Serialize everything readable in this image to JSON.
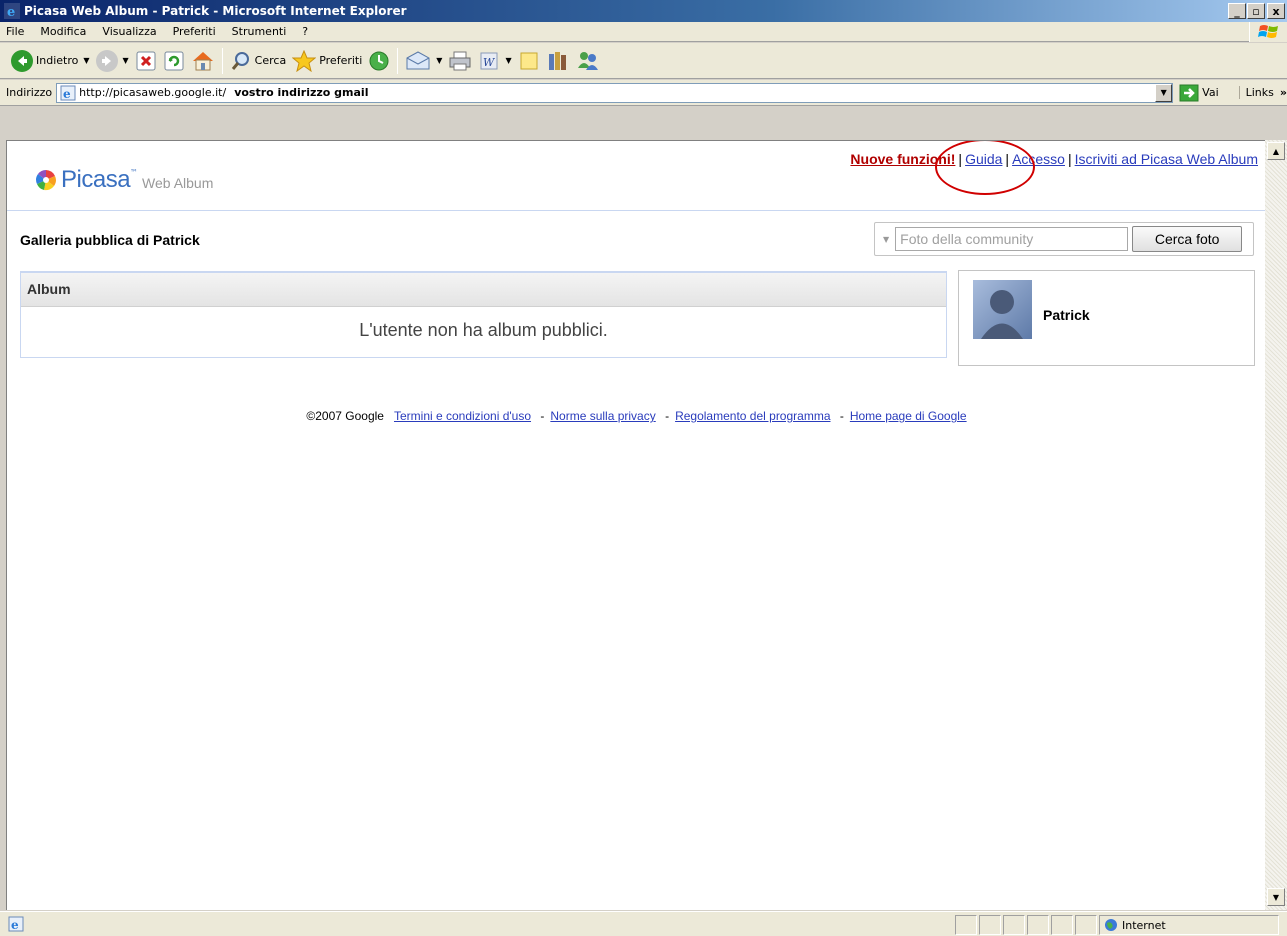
{
  "window": {
    "title": "Picasa Web Album - Patrick - Microsoft Internet Explorer",
    "min": "_",
    "max": "▫",
    "close": "x"
  },
  "menu": [
    "File",
    "Modifica",
    "Visualizza",
    "Preferiti",
    "Strumenti",
    "?"
  ],
  "toolbar": {
    "back": "Indietro",
    "search": "Cerca",
    "favorites": "Preferiti"
  },
  "address": {
    "label": "Indirizzo",
    "url": "http://picasaweb.google.it/",
    "hint": "vostro indirizzo gmail",
    "go": "Vai",
    "links": "Links",
    "links_more": "»"
  },
  "picasa": {
    "logo": "Picasa",
    "tm": "™",
    "logo_sub": "Web Album",
    "links": {
      "new_features": "Nuove funzioni!",
      "help": "Guida",
      "login": "Accesso",
      "signup": "Iscriviti ad Picasa Web Album"
    },
    "gallery_title": "Galleria pubblica di Patrick",
    "search_placeholder": "Foto della community",
    "search_button": "Cerca foto",
    "album_header": "Album",
    "album_empty": "L'utente non ha album pubblici.",
    "profile_name": "Patrick"
  },
  "footer": {
    "copyright": "©2007 Google",
    "terms": "Termini e condizioni d'uso",
    "privacy": "Norme sulla privacy",
    "program": "Regolamento del programma",
    "home": "Home page di Google",
    "dash": "-"
  },
  "status": {
    "zone": "Internet"
  },
  "colors": {
    "titlebar": "#0a246a",
    "link": "#2a3cbc",
    "new_features": "#b00000",
    "annotation_circle": "#d00000"
  }
}
